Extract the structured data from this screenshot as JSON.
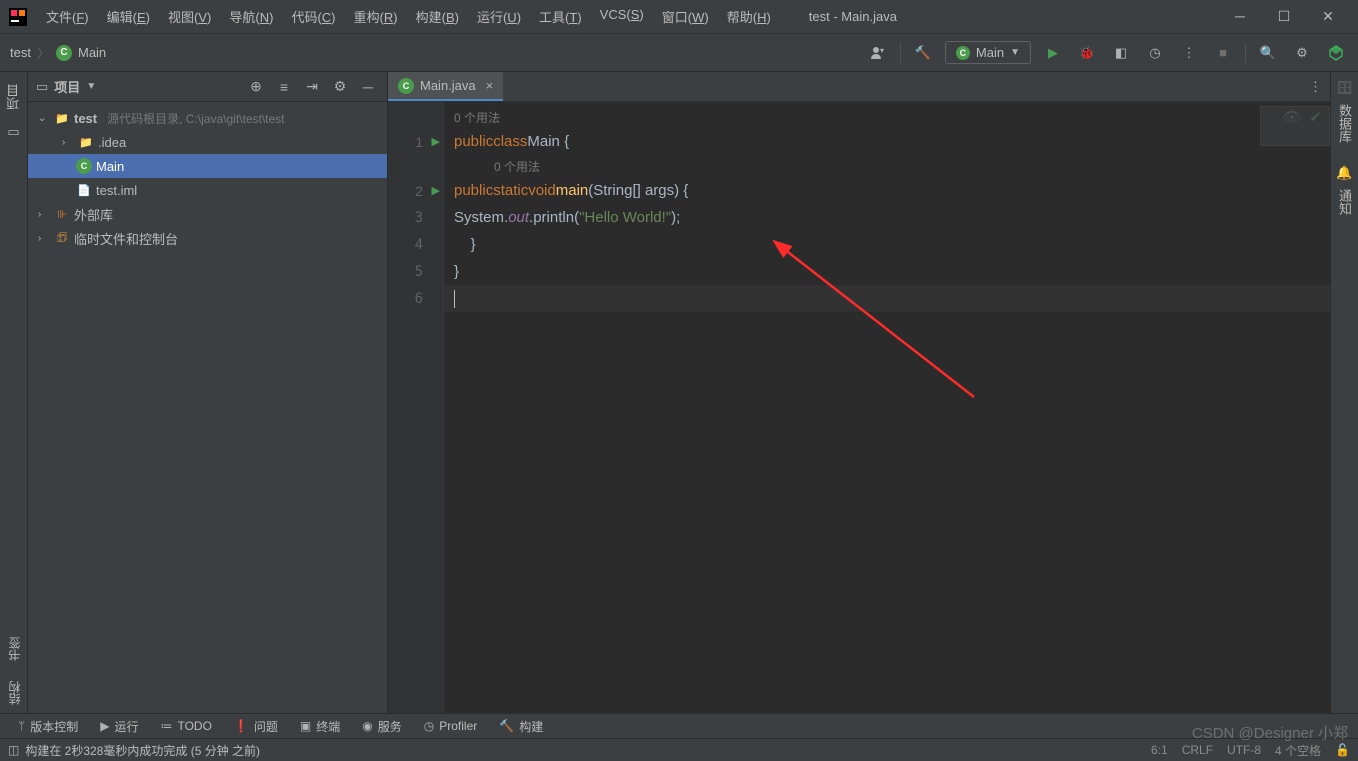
{
  "window_title": "test - Main.java",
  "menus": [
    {
      "label": "文件",
      "key": "F"
    },
    {
      "label": "编辑",
      "key": "E"
    },
    {
      "label": "视图",
      "key": "V"
    },
    {
      "label": "导航",
      "key": "N"
    },
    {
      "label": "代码",
      "key": "C"
    },
    {
      "label": "重构",
      "key": "R"
    },
    {
      "label": "构建",
      "key": "B"
    },
    {
      "label": "运行",
      "key": "U"
    },
    {
      "label": "工具",
      "key": "T"
    },
    {
      "label": "VCS",
      "key": "S"
    },
    {
      "label": "窗口",
      "key": "W"
    },
    {
      "label": "帮助",
      "key": "H"
    }
  ],
  "breadcrumb": {
    "project": "test",
    "file": "Main"
  },
  "run_config": {
    "name": "Main"
  },
  "project_panel": {
    "title": "项目",
    "tree": {
      "root": {
        "name": "test",
        "hint": "源代码根目录, C:\\java\\git\\test\\test"
      },
      "idea": ".idea",
      "main": "Main",
      "iml": "test.iml",
      "ext_libs": "外部库",
      "scratches": "临时文件和控制台"
    }
  },
  "left_stripe": {
    "project": "项目"
  },
  "right_stripe": {
    "db": "数据库",
    "notify": "通知"
  },
  "left_bottom": {
    "bookmarks": "书签",
    "structure": "结构"
  },
  "editor": {
    "tab_name": "Main.java",
    "usages_hint": "0 个用法",
    "lines": [
      "1",
      "2",
      "3",
      "4",
      "5",
      "6"
    ],
    "code": {
      "l1": {
        "kw1": "public",
        "kw2": "class",
        "name": "Main",
        "brace": " {"
      },
      "l2": {
        "kw1": "public",
        "kw2": "static",
        "kw3": "void",
        "name": "main",
        "params": "(String[] args) {"
      },
      "l3": {
        "sys": "System.",
        "out": "out",
        "println": ".println(",
        "str": "\"Hello World!\"",
        "end": ");"
      },
      "l4": "    }",
      "l5": "}",
      "l6": ""
    }
  },
  "bottom_tools": {
    "vcs": "版本控制",
    "run": "运行",
    "todo": "TODO",
    "problems": "问题",
    "terminal": "终端",
    "services": "服务",
    "profiler": "Profiler",
    "build": "构建"
  },
  "status": {
    "message": "构建在 2秒328毫秒内成功完成 (5 分钟 之前)",
    "pos": "6:1",
    "line_sep": "CRLF",
    "encoding": "UTF-8",
    "indent": "4 个空格"
  },
  "watermark": "CSDN @Designer 小郑"
}
